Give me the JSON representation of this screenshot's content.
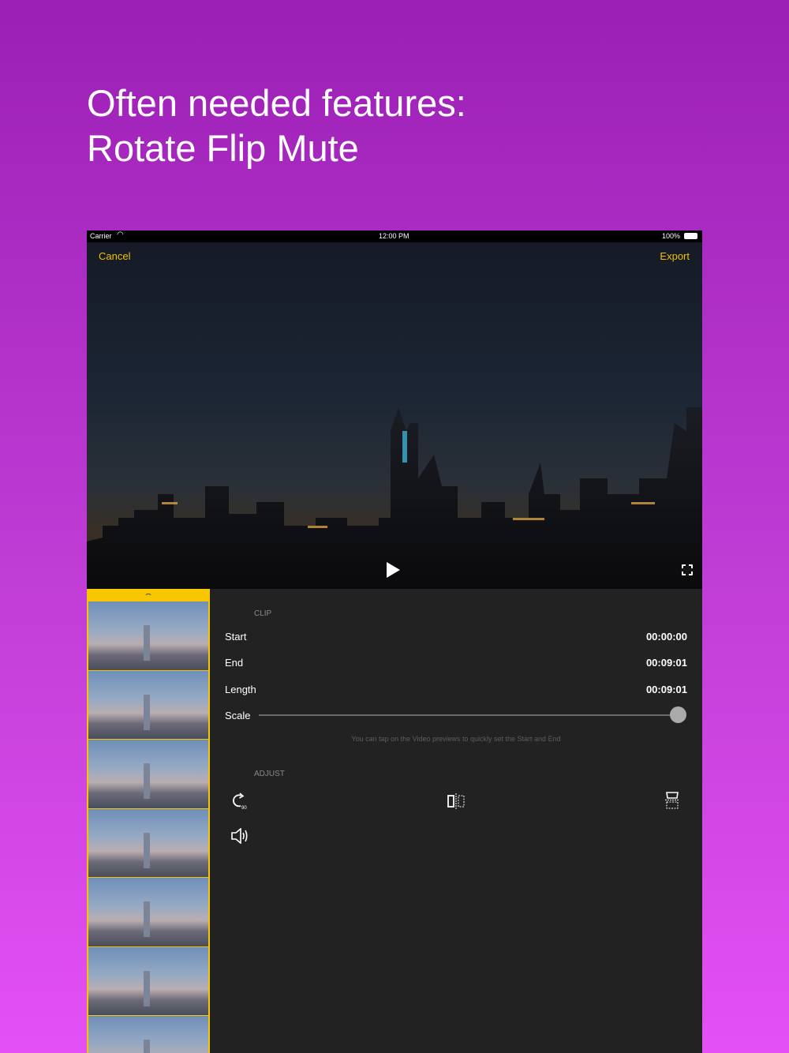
{
  "headline": {
    "line1": "Often needed features:",
    "line2": "Rotate Flip Mute"
  },
  "status_bar": {
    "carrier": "Carrier",
    "time": "12:00 PM",
    "battery": "100%"
  },
  "nav": {
    "cancel": "Cancel",
    "export": "Export"
  },
  "clip": {
    "section": "CLIP",
    "start_label": "Start",
    "start_value": "00:00:00",
    "end_label": "End",
    "end_value": "00:09:01",
    "length_label": "Length",
    "length_value": "00:09:01",
    "scale_label": "Scale",
    "scale_value": 1.0,
    "hint": "You can tap on the Video previews to quickly set the Start and End"
  },
  "adjust": {
    "section": "ADJUST",
    "rotate_badge": "90"
  },
  "colors": {
    "accent": "#f2c200",
    "panel": "#222222"
  }
}
